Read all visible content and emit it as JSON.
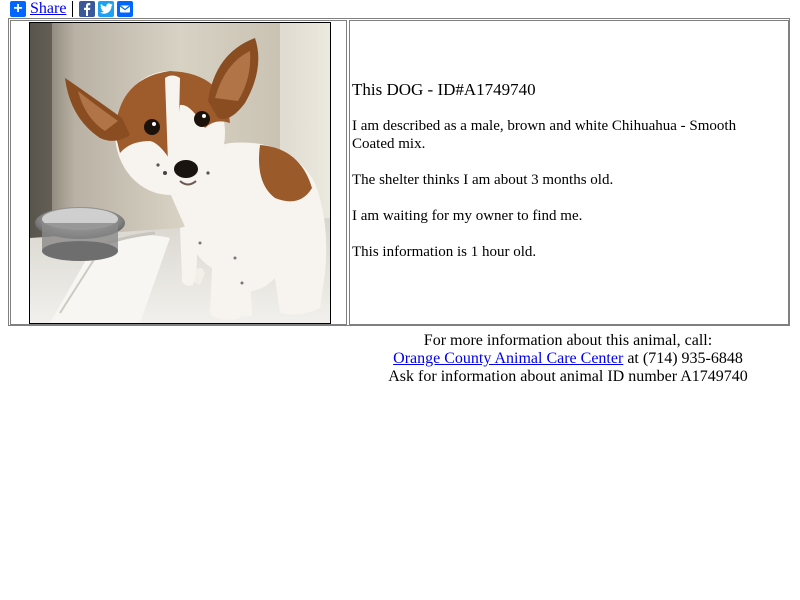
{
  "share": {
    "label": "Share",
    "icons": [
      "plus-icon",
      "facebook-icon",
      "twitter-icon",
      "email-icon"
    ],
    "colors": {
      "plus": "#0166ff",
      "facebook": "#3b5998",
      "twitter": "#1da1f2",
      "email": "#0166ff"
    }
  },
  "animal": {
    "title_prefix": "This DOG - ",
    "title_id": "ID#A1749740",
    "description": "I am described as a male, brown and white Chihuahua - Smooth Coated mix.",
    "age": "The shelter thinks I am about 3 months old.",
    "status": "I am waiting for my owner to find me.",
    "freshness": "This information is 1 hour old."
  },
  "contact": {
    "intro": "For more information about this animal, call:",
    "shelter_name": "Orange County Animal Care Center",
    "phone_text": " at (714) 935-6848",
    "ask_text": "Ask for information about animal ID number A1749740"
  },
  "colors": {
    "link": "#0000ee",
    "border": "#808080"
  }
}
